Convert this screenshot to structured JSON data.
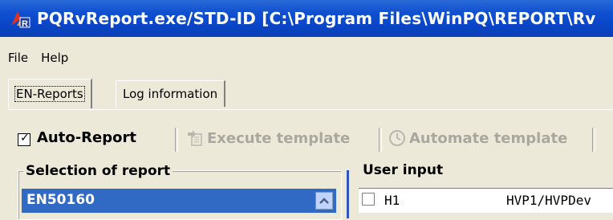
{
  "window": {
    "title": "PQRvReport.exe/STD-ID [C:\\Program Files\\WinPQ\\REPORT\\Rv"
  },
  "menu": {
    "items": [
      "File",
      "Help"
    ]
  },
  "tabs": [
    {
      "label": "EN-Reports",
      "active": true
    },
    {
      "label": "Log information",
      "active": false
    }
  ],
  "toolbar": {
    "auto_report_label": "Auto-Report",
    "auto_report_checked": true,
    "execute_template_label": "Execute template",
    "automate_template_label": "Automate template"
  },
  "selection_of_report": {
    "title": "Selection of report",
    "selected_item": "EN50160"
  },
  "user_input": {
    "title": "User input",
    "rows": [
      {
        "checked": false,
        "name": "H1",
        "value": "HVP1/HVPDev"
      }
    ]
  },
  "colors": {
    "titlebar": "#0a45c8",
    "selection": "#316ac5",
    "window_bg": "#ece9d8"
  }
}
